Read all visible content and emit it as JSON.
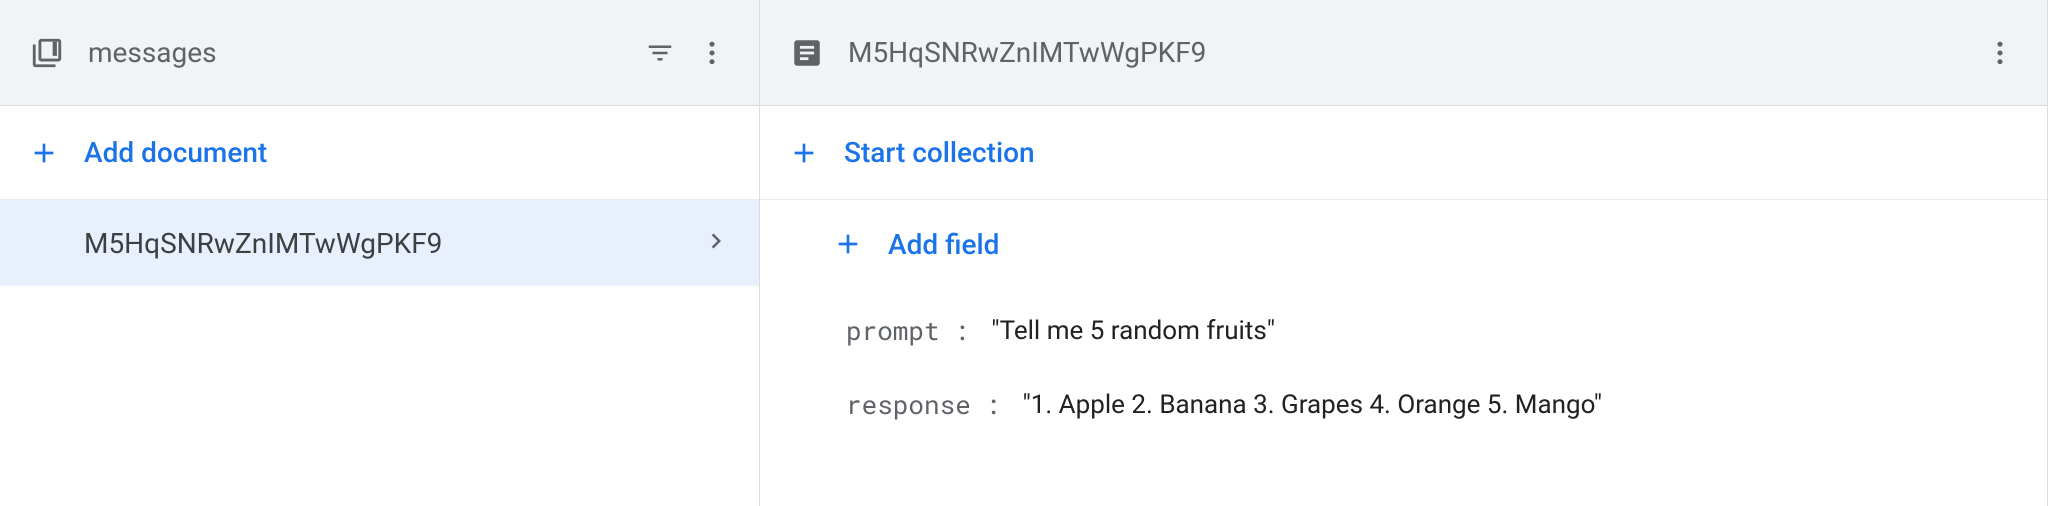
{
  "collection_panel": {
    "title": "messages",
    "add_button_label": "Add document",
    "documents": [
      {
        "id": "M5HqSNRwZnIMTwWgPKF9",
        "selected": true
      }
    ]
  },
  "document_panel": {
    "title": "M5HqSNRwZnIMTwWgPKF9",
    "start_collection_label": "Start collection",
    "add_field_label": "Add field",
    "fields": [
      {
        "key": "prompt",
        "value": "\"Tell me 5 random fruits\""
      },
      {
        "key": "response",
        "value": "\"1. Apple 2. Banana 3. Grapes 4. Orange 5. Mango\""
      }
    ]
  },
  "colors": {
    "accent": "#1a73e8",
    "muted": "#5f6368",
    "selection": "#e8f0fe",
    "header_bg": "#f1f3f4"
  }
}
